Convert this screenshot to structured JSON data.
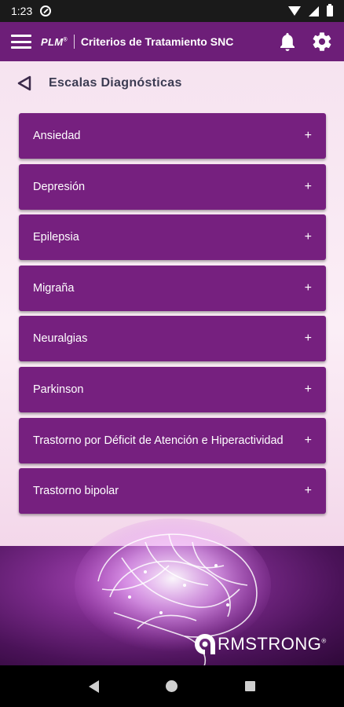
{
  "status_bar": {
    "time": "1:23"
  },
  "app_bar": {
    "brand": "PLM",
    "brand_mark": "®",
    "title": "Criterios de Tratamiento SNC",
    "icons": [
      "menu-icon",
      "bell-icon",
      "gear-icon"
    ]
  },
  "section": {
    "title": "Escalas Diagnósticas",
    "back_icon": "back-triangle-icon"
  },
  "list": {
    "items": [
      {
        "label": "Ansiedad",
        "expand": "+"
      },
      {
        "label": "Depresión",
        "expand": "+"
      },
      {
        "label": "Epilepsia",
        "expand": "+"
      },
      {
        "label": "Migraña",
        "expand": "+"
      },
      {
        "label": "Neuralgias",
        "expand": "+"
      },
      {
        "label": "Parkinson",
        "expand": "+"
      },
      {
        "label": "Trastorno por Déficit de Atención e Hiperactividad",
        "expand": "+"
      },
      {
        "label": "Trastorno bipolar",
        "expand": "+"
      }
    ]
  },
  "footer": {
    "logo_text": "RMSTRONG",
    "logo_mark": "®"
  },
  "colors": {
    "primary": "#6d1e78",
    "item": "#76207f",
    "background": "#f7e9f3"
  }
}
